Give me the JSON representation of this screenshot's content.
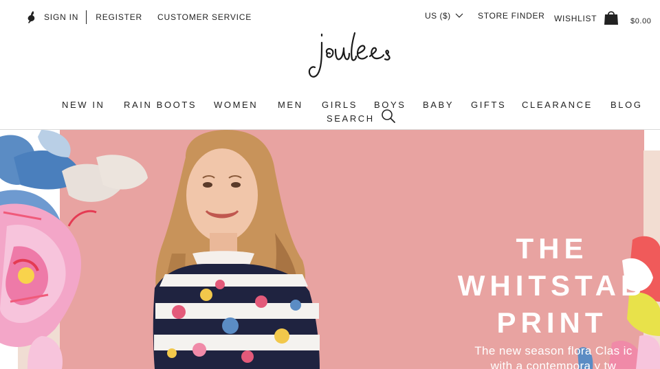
{
  "header": {
    "sign_in": "SIGN IN",
    "register": "REGISTER",
    "customer_service": "CUSTOMER SERVICE",
    "currency": "US ($)",
    "store_finder": "STORE FINDER",
    "wishlist": "WISHLIST",
    "bag_total": "$0.00"
  },
  "nav": {
    "items": [
      "NEW IN",
      "RAIN BOOTS",
      "WOMEN",
      "MEN",
      "GIRLS",
      "BOYS",
      "BABY",
      "GIFTS",
      "CLEARANCE",
      "BLOG"
    ],
    "search": "SEARCH"
  },
  "hero": {
    "title_line1": "THE",
    "title_line2": "WHITSTAB",
    "title_line3": "PRINT",
    "subtitle_line1": "The new season flora  Clas ic",
    "subtitle_line2": "with a contempora y tw"
  },
  "colors": {
    "hero_pink": "#e8a3a1",
    "text": "#222222"
  },
  "icons": [
    "hare-icon",
    "chevron-down-icon",
    "shopping-bag-icon",
    "search-icon"
  ]
}
